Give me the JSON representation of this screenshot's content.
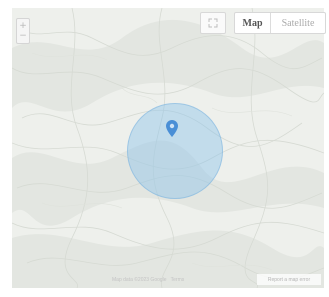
{
  "map": {
    "type_control": {
      "map_label": "Map",
      "satellite_label": "Satellite",
      "selected": "Map"
    },
    "zoom_in_glyph": "+",
    "zoom_out_glyph": "−",
    "fullscreen_icon": "fullscreen-icon",
    "marker_icon": "map-pin-icon",
    "radius_color": "#8cc3eb",
    "marker_color": "#4a8fd6"
  },
  "footer": {
    "attribution": "Map data ©2023 Google",
    "terms": "Terms",
    "report": "Report a map error"
  }
}
